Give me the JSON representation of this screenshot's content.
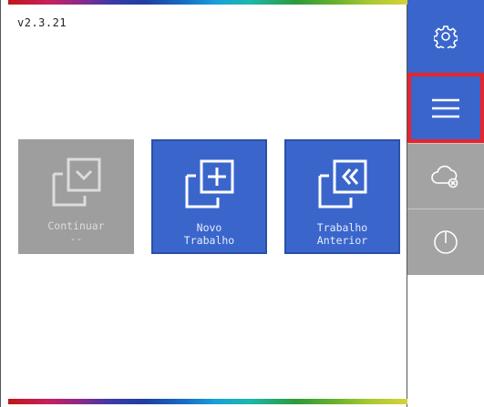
{
  "app": {
    "version": "v2.3.21"
  },
  "tiles": [
    {
      "id": "continue",
      "line1": "Continuar",
      "line2": "--",
      "icon": "continue-copy-icon"
    },
    {
      "id": "new",
      "line1": "Novo",
      "line2": "Trabalho",
      "icon": "new-job-plus-icon"
    },
    {
      "id": "previous",
      "line1": "Trabalho",
      "line2": "Anterior",
      "icon": "previous-job-rewind-icon"
    }
  ],
  "sidebar": {
    "buttons": [
      {
        "id": "settings",
        "icon": "gear-icon",
        "state": "default"
      },
      {
        "id": "menu",
        "icon": "hamburger-menu-icon",
        "state": "selected"
      },
      {
        "id": "cloud",
        "icon": "cloud-disconnected-icon",
        "state": "disabled"
      },
      {
        "id": "power",
        "icon": "power-icon",
        "state": "disabled"
      }
    ]
  },
  "colors": {
    "accent_blue": "#3a66cc",
    "disabled_gray": "#9e9e9e",
    "selection_red": "#e8242c"
  }
}
